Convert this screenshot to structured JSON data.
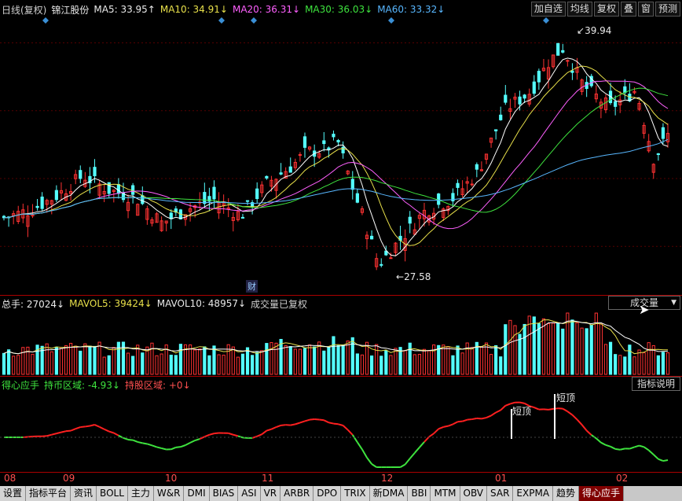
{
  "header": {
    "period": "日线(复权)",
    "stock_name": "锦江股份",
    "ma5": "MA5: 33.95↑",
    "ma10": "MA10: 34.91↓",
    "ma20": "MA20: 36.31↓",
    "ma30": "MA30: 36.03↓",
    "ma60": "MA60: 33.32↓",
    "buttons": [
      "加自选",
      "均线",
      "复权",
      "叠",
      "窗",
      "预测"
    ]
  },
  "price_annotations": {
    "high": "39.94",
    "low": "27.58",
    "marker": "财"
  },
  "volume_header": {
    "total": "总手: 27024↓",
    "mavol5": "MAVOL5: 39424↓",
    "mavol10": "MAVOL10: 48957↓",
    "note": "成交量已复权",
    "selector": "成交量"
  },
  "indicator_header": {
    "name": "得心应手",
    "hold": "持币区域: -4.93↓",
    "position": "持股区域: +0↓",
    "help_button": "指标说明",
    "top_labels": [
      "短顶",
      "短顶"
    ]
  },
  "dates": [
    "08",
    "09",
    "10",
    "11",
    "12",
    "01",
    "02"
  ],
  "tabs": [
    "设置",
    "指标平台",
    "资讯",
    "BOLL",
    "主力",
    "W&R",
    "DMI",
    "BIAS",
    "ASI",
    "VR",
    "ARBR",
    "DPO",
    "TRIX",
    "新DMA",
    "BBI",
    "MTM",
    "OBV",
    "SAR",
    "EXPMA",
    "趋势",
    "得心应手"
  ],
  "active_tab": "得心应手",
  "colors": {
    "up": "#ff3232",
    "down": "#54ffff",
    "ma5": "#ffffff",
    "ma10": "#e8e04a",
    "ma20": "#ff60ff",
    "ma30": "#3ee33e",
    "ma60": "#58b7ff"
  },
  "chart_data": {
    "type": "candlestick",
    "price_range": [
      26.5,
      41
    ],
    "low_price": 27.58,
    "high_price": 39.94
  }
}
